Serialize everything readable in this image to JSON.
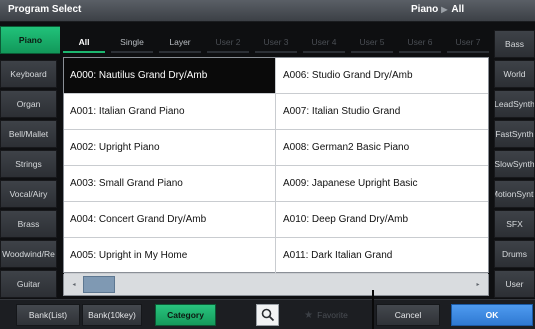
{
  "title": "Program Select",
  "breadcrumb": [
    "Piano",
    "All"
  ],
  "left_categories": [
    {
      "label": "Piano",
      "selected": true
    },
    {
      "label": "Keyboard",
      "selected": false
    },
    {
      "label": "Organ",
      "selected": false
    },
    {
      "label": "Bell/Mallet",
      "selected": false
    },
    {
      "label": "Strings",
      "selected": false
    },
    {
      "label": "Vocal/Airy",
      "selected": false
    },
    {
      "label": "Brass",
      "selected": false
    },
    {
      "label": "Woodwind/Re",
      "selected": false
    },
    {
      "label": "Guitar",
      "selected": false
    }
  ],
  "right_categories": [
    {
      "label": "Bass"
    },
    {
      "label": "World"
    },
    {
      "label": "LeadSynth"
    },
    {
      "label": "FastSynth"
    },
    {
      "label": "SlowSynth"
    },
    {
      "label": "MotionSynth"
    },
    {
      "label": "SFX"
    },
    {
      "label": "Drums"
    },
    {
      "label": "User"
    }
  ],
  "subtabs": [
    {
      "label": "All",
      "state": "on"
    },
    {
      "label": "Single",
      "state": "normal"
    },
    {
      "label": "Layer",
      "state": "normal"
    },
    {
      "label": "User 2",
      "state": "dim"
    },
    {
      "label": "User 3",
      "state": "dim"
    },
    {
      "label": "User 4",
      "state": "dim"
    },
    {
      "label": "User 5",
      "state": "dim"
    },
    {
      "label": "User 6",
      "state": "dim"
    },
    {
      "label": "User 7",
      "state": "dim"
    }
  ],
  "programs": [
    [
      "A000: Nautilus Grand Dry/Amb",
      "A006: Studio Grand Dry/Amb"
    ],
    [
      "A001: Italian Grand Piano",
      "A007: Italian Studio Grand"
    ],
    [
      "A002: Upright Piano",
      "A008: German2 Basic Piano"
    ],
    [
      "A003: Small Grand Piano",
      "A009: Japanese Upright Basic"
    ],
    [
      "A004: Concert Grand Dry/Amb",
      "A010: Deep Grand Dry/Amb"
    ],
    [
      "A005: Upright in My Home",
      "A011: Dark Italian Grand"
    ]
  ],
  "selected_program": "A000: Nautilus Grand Dry/Amb",
  "scrollbar": {
    "left_arrow": "◂",
    "right_arrow": "▸",
    "position": 0.0
  },
  "bottom": {
    "bank_list": "Bank(List)",
    "bank_10key": "Bank(10key)",
    "category": "Category",
    "search_icon": "search-icon",
    "favorite": "Favorite",
    "cancel": "Cancel",
    "ok": "OK"
  },
  "colors": {
    "accent_green": "#1db76f",
    "ok_blue": "#3a86e0",
    "selected_cell": "#0a0a0a"
  }
}
